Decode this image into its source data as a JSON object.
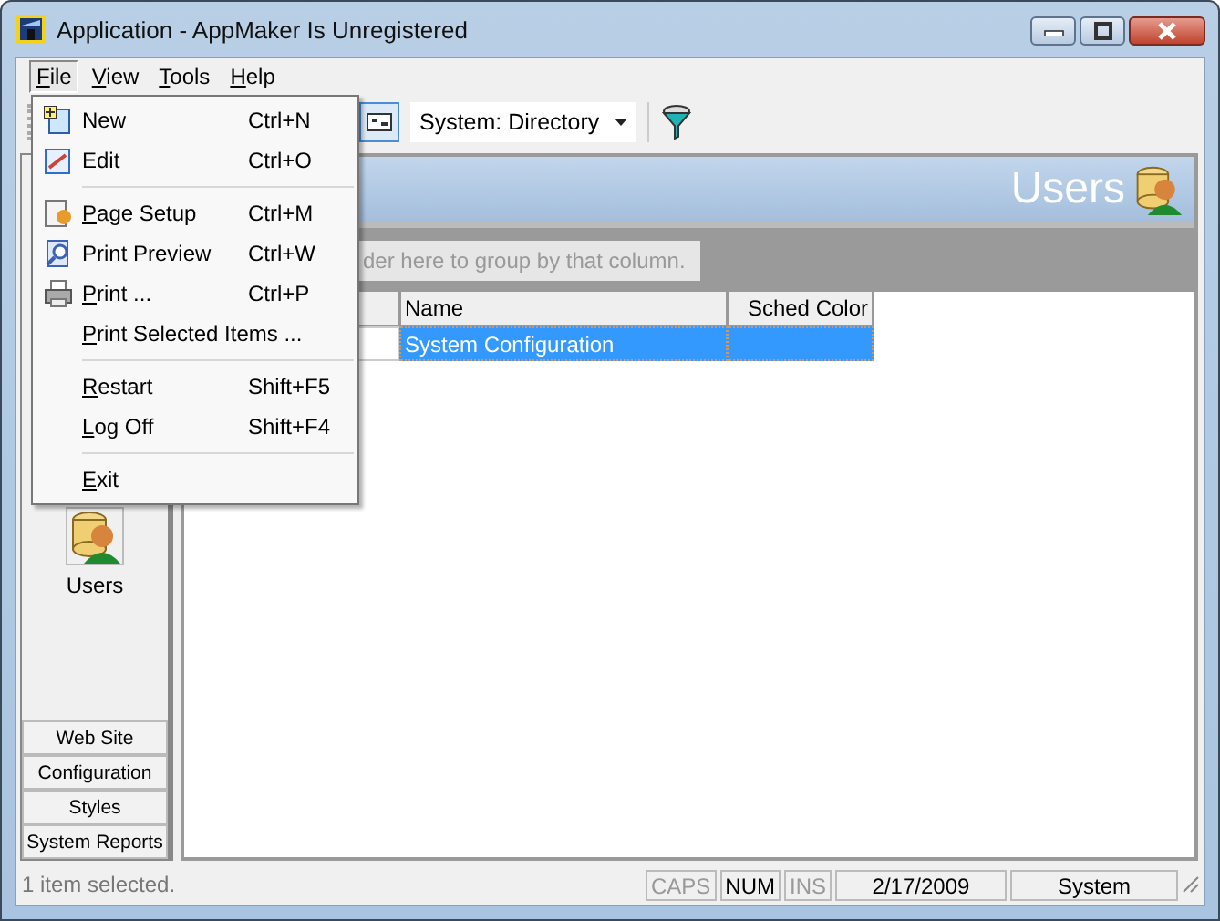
{
  "window": {
    "title": "Application - AppMaker Is Unregistered"
  },
  "menubar": [
    {
      "label": "File",
      "selected": true
    },
    {
      "label": "View",
      "selected": false
    },
    {
      "label": "Tools",
      "selected": false
    },
    {
      "label": "Help",
      "selected": false
    }
  ],
  "file_menu": {
    "groups": [
      [
        {
          "label": "New",
          "shortcut": "Ctrl+N",
          "mnemonic": false,
          "has_icon": true
        },
        {
          "label": "Edit",
          "shortcut": "Ctrl+O",
          "mnemonic": false,
          "has_icon": true
        }
      ],
      [
        {
          "label": "Page Setup",
          "shortcut": "Ctrl+M",
          "mnemonic": true,
          "has_icon": true
        },
        {
          "label": "Print Preview",
          "shortcut": "Ctrl+W",
          "mnemonic": false,
          "has_icon": true
        },
        {
          "label": "Print ...",
          "shortcut": "Ctrl+P",
          "mnemonic": true,
          "has_icon": true
        },
        {
          "label": "Print Selected Items ...",
          "mnemonic": true,
          "has_icon": false
        }
      ],
      [
        {
          "label": "Restart",
          "shortcut": "Shift+F5",
          "mnemonic": true,
          "has_icon": false
        },
        {
          "label": "Log Off",
          "shortcut": "Shift+F4",
          "mnemonic": true,
          "has_icon": false
        }
      ],
      [
        {
          "label": "Exit",
          "mnemonic": true,
          "has_icon": false
        }
      ]
    ]
  },
  "toolbar": {
    "combo": "System: Directory"
  },
  "sidebar": {
    "items": [
      {
        "label": "Users"
      }
    ],
    "sections": [
      "Web Site",
      "Configuration",
      "Styles",
      "System Reports"
    ]
  },
  "header": {
    "title": "Users"
  },
  "group_panel": {
    "hint": "der here to group by that column."
  },
  "table": {
    "columns": [
      "Name",
      "Sched Color"
    ],
    "rows": [
      {
        "name": "System Configuration",
        "selected": true
      }
    ]
  },
  "status_bar": {
    "message": "1 item selected.",
    "indicators": [
      {
        "label": "CAPS",
        "on": false
      },
      {
        "label": "NUM",
        "on": true
      },
      {
        "label": "INS",
        "on": false
      }
    ],
    "date": "2/17/2009",
    "user": "System"
  }
}
